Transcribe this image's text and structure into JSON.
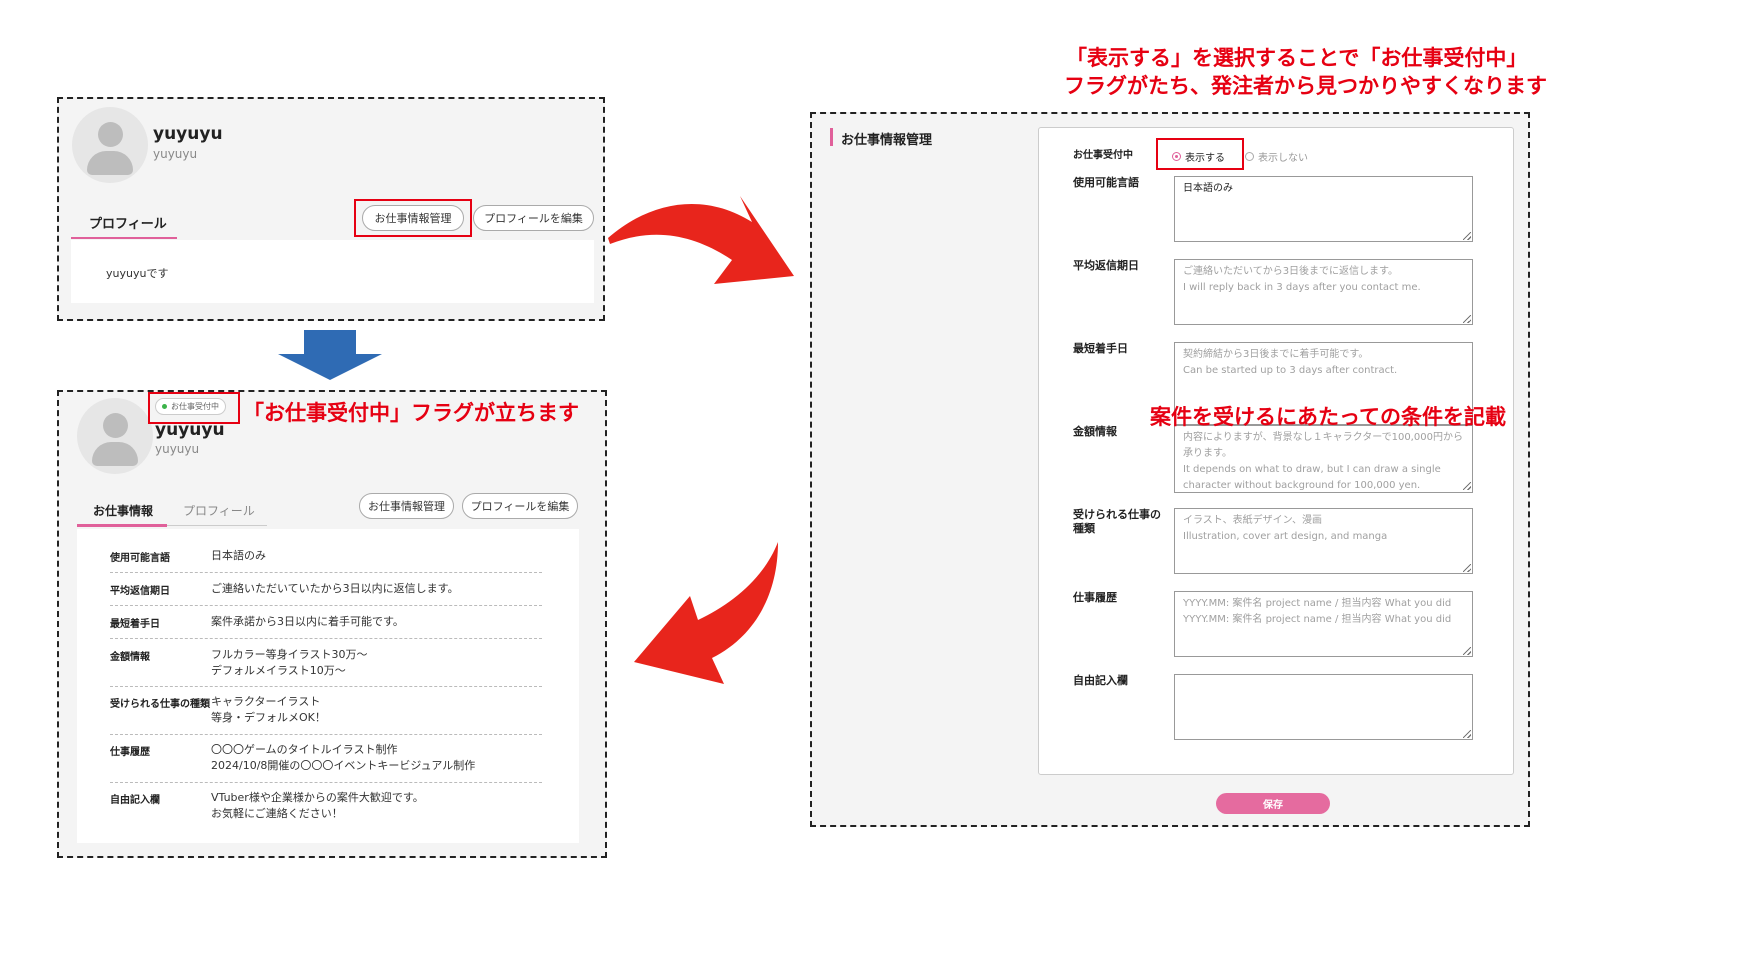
{
  "annotations": {
    "top_right_line1": "「表示する」を選択することで「お仕事受付中」",
    "top_right_line2": "フラグがたち、発注者から見つかりやすくなります",
    "flag_note": "「お仕事受付中」フラグが立ちます",
    "conditions_note": "案件を受けるにあたっての条件を記載"
  },
  "profile_before": {
    "username": "yuyuyu",
    "user_id": "yuyuyu",
    "tab_profile": "プロフィール",
    "btn_job_manage": "お仕事情報管理",
    "btn_edit_profile": "プロフィールを編集",
    "bio": "yuyuyuです"
  },
  "profile_after": {
    "badge": "お仕事受付中",
    "username": "yuyuyu",
    "user_id": "yuyuyu",
    "tab_job": "お仕事情報",
    "tab_profile": "プロフィール",
    "btn_job_manage": "お仕事情報管理",
    "btn_edit_profile": "プロフィールを編集",
    "rows": [
      {
        "label": "使用可能言語",
        "value": "日本語のみ"
      },
      {
        "label": "平均返信期日",
        "value": "ご連絡いただいていたから3日以内に返信します。"
      },
      {
        "label": "最短着手日",
        "value": "案件承諾から3日以内に着手可能です。"
      },
      {
        "label": "金額情報",
        "value": "フルカラー等身イラスト30万〜\nデフォルメイラスト10万〜"
      },
      {
        "label": "受けられる仕事の種類",
        "value": "キャラクターイラスト\n等身・デフォルメOK！"
      },
      {
        "label": "仕事履歴",
        "value": "〇〇〇ゲームのタイトルイラスト制作\n2024/10/8開催の〇〇〇イベントキービジュアル制作"
      },
      {
        "label": "自由記入欄",
        "value": "VTuber様や企業様からの案件大歓迎です。\nお気軽にご連絡ください！"
      }
    ]
  },
  "job_form": {
    "section_title": "お仕事情報管理",
    "accepting_label": "お仕事受付中",
    "radio_show": "表示する",
    "radio_hide": "表示しない",
    "fields": [
      {
        "label": "使用可能言語",
        "value": "日本語のみ",
        "placeholder": ""
      },
      {
        "label": "平均返信期日",
        "value": "",
        "placeholder": "ご連絡いただいてから3日後までに返信します。\nI will reply back in 3 days after you contact me."
      },
      {
        "label": "最短着手日",
        "value": "",
        "placeholder": "契約締結から3日後までに着手可能です。\nCan be started up to 3 days after contract."
      },
      {
        "label": "金額情報",
        "value": "",
        "placeholder": "内容によりますが、背景なし１キャラクターで100,000円から承ります。\nIt depends on what to draw, but I can draw a single character without background for 100,000 yen."
      },
      {
        "label": "受けられる仕事の種類",
        "value": "",
        "placeholder": "イラスト、表紙デザイン、漫画\nIllustration, cover art design, and manga"
      },
      {
        "label": "仕事履歴",
        "value": "",
        "placeholder": "YYYY.MM: 案件名 project name / 担当内容 What you did\nYYYY.MM: 案件名 project name / 担当内容 What you did"
      },
      {
        "label": "自由記入欄",
        "value": "",
        "placeholder": ""
      }
    ],
    "save_label": "保存"
  },
  "colors": {
    "annotation_red": "#e60012",
    "accent_pink": "#e0609a",
    "save_button": "#e56b9f",
    "arrow_blue": "#2f6bb4",
    "badge_green": "#3cb34a"
  }
}
